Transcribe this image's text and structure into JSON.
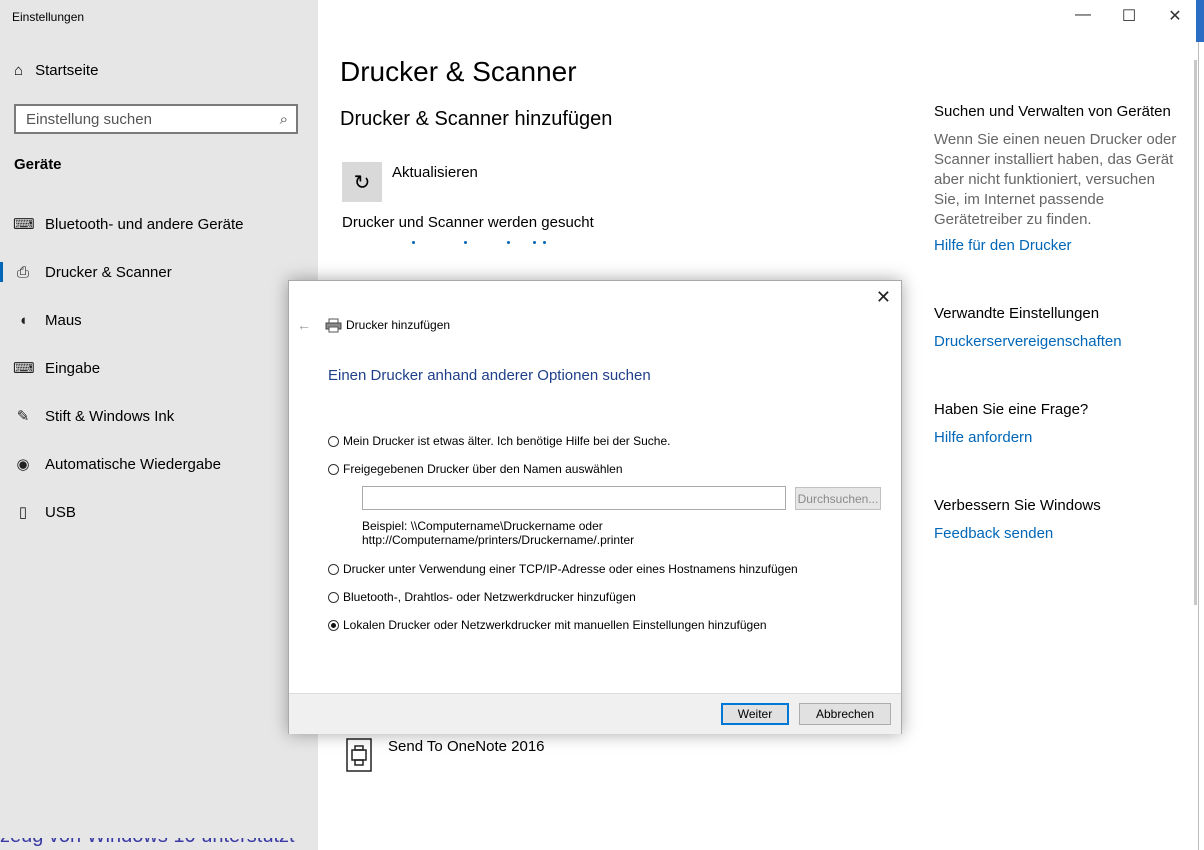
{
  "window": {
    "title": "Einstellungen"
  },
  "sidebar": {
    "home_label": "Startseite",
    "search_placeholder": "Einstellung suchen",
    "category": "Geräte",
    "items": [
      {
        "label": "Bluetooth- und andere Geräte",
        "icon": "bluetooth-devices-icon"
      },
      {
        "label": "Drucker & Scanner",
        "icon": "printer-icon",
        "active": true
      },
      {
        "label": "Maus",
        "icon": "mouse-icon"
      },
      {
        "label": "Eingabe",
        "icon": "keyboard-icon"
      },
      {
        "label": "Stift & Windows Ink",
        "icon": "pen-icon"
      },
      {
        "label": "Automatische Wiedergabe",
        "icon": "autoplay-icon"
      },
      {
        "label": "USB",
        "icon": "usb-icon"
      }
    ]
  },
  "main": {
    "page_title": "Drucker & Scanner",
    "section_title": "Drucker & Scanner hinzufügen",
    "refresh_label": "Aktualisieren",
    "searching_text": "Drucker und Scanner werden gesucht",
    "printer_item": "Send To OneNote 2016"
  },
  "right_column": {
    "manage_title": "Suchen und Verwalten von Geräten",
    "manage_text": "Wenn Sie einen neuen Drucker oder Scanner installiert haben, das Gerät aber nicht funktioniert, versuchen Sie, im Internet passende Gerätetreiber zu finden.",
    "manage_link": "Hilfe für den Drucker",
    "related_title": "Verwandte Einstellungen",
    "related_link": "Druckerservereigenschaften",
    "question_title": "Haben Sie eine Frage?",
    "question_link": "Hilfe anfordern",
    "improve_title": "Verbessern Sie Windows",
    "improve_link": "Feedback senden"
  },
  "dialog": {
    "title": "Drucker hinzufügen",
    "heading": "Einen Drucker anhand anderer Optionen suchen",
    "options": [
      {
        "label": "Mein Drucker ist etwas älter. Ich benötige Hilfe bei der Suche.",
        "selected": false
      },
      {
        "label": "Freigegebenen Drucker über den Namen auswählen",
        "selected": false
      },
      {
        "label": "Drucker unter Verwendung einer TCP/IP-Adresse oder eines Hostnamens hinzufügen",
        "selected": false
      },
      {
        "label": "Bluetooth-, Drahtlos- oder Netzwerkdrucker hinzufügen",
        "selected": false
      },
      {
        "label": "Lokalen Drucker oder Netzwerkdrucker mit manuellen Einstellungen hinzufügen",
        "selected": true
      }
    ],
    "name_input_value": "",
    "browse_label": "Durchsuchen...",
    "example_line1": "Beispiel: \\\\Computername\\Druckername oder",
    "example_line2": "http://Computername/printers/Druckername/.printer",
    "next_label": "Weiter",
    "cancel_label": "Abbrechen"
  },
  "background_text": "zeug von Windows 10 unterstützt",
  "colors": {
    "accent": "#0067b8",
    "sidebar_bg": "#e6e6e6",
    "dialog_heading": "#1f3f8a"
  }
}
